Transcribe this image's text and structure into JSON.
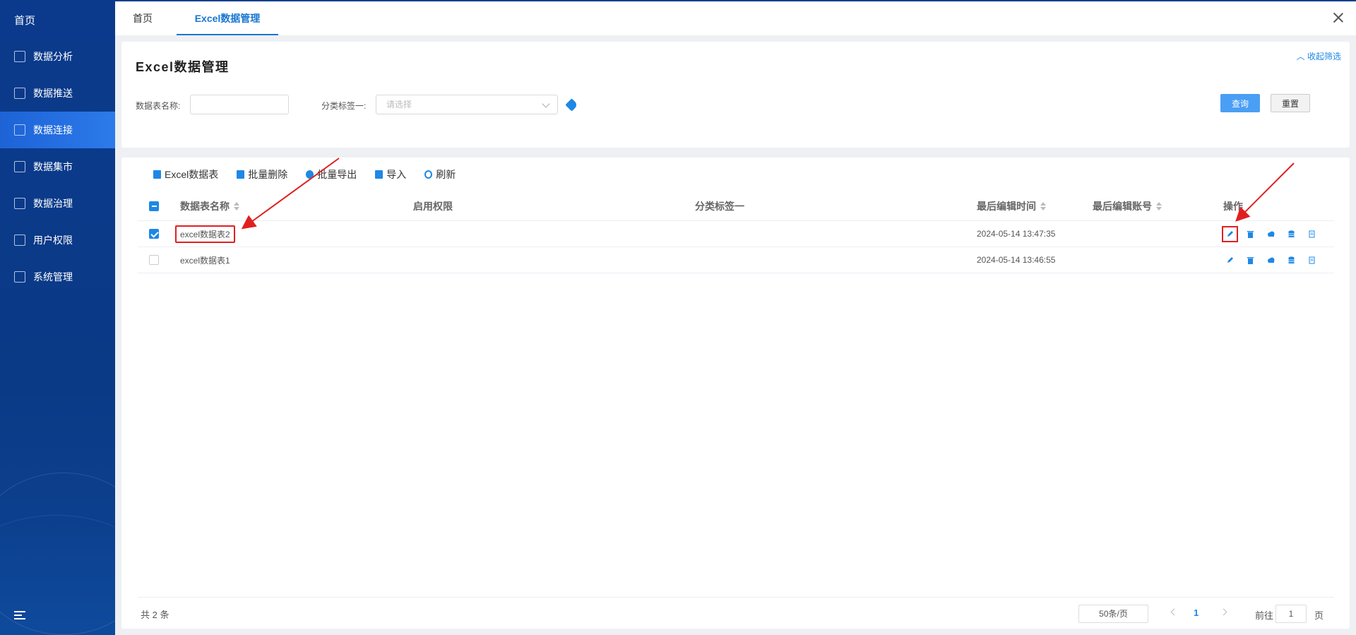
{
  "sidebar": {
    "brand": "首页",
    "items": [
      {
        "label": "数据分析",
        "icon": "chart-icon"
      },
      {
        "label": "数据推送",
        "icon": "bar-chart-icon"
      },
      {
        "label": "数据连接",
        "icon": "connection-icon",
        "active": true
      },
      {
        "label": "数据集市",
        "icon": "monitor-icon"
      },
      {
        "label": "数据治理",
        "icon": "layers-icon"
      },
      {
        "label": "用户权限",
        "icon": "user-permission-icon"
      },
      {
        "label": "系统管理",
        "icon": "system-icon"
      }
    ]
  },
  "tabs": [
    {
      "label": "首页"
    },
    {
      "label": "Excel数据管理",
      "active": true
    }
  ],
  "filter": {
    "title": "Excel数据管理",
    "collapse_label": "收起筛选",
    "name_label": "数据表名称:",
    "name_value": "",
    "tag_label": "分类标签一:",
    "tag_placeholder": "请选择",
    "query_label": "查询",
    "reset_label": "重置"
  },
  "toolbar": {
    "excel": "Excel数据表",
    "batch_delete": "批量删除",
    "batch_export": "批量导出",
    "import": "导入",
    "refresh": "刷新"
  },
  "table": {
    "headers": {
      "name": "数据表名称",
      "permission": "启用权限",
      "tag": "分类标签一",
      "time": "最后编辑时间",
      "account": "最后编辑账号",
      "ops": "操作"
    },
    "rows": [
      {
        "name": "excel数据表2",
        "permission": "",
        "tag": "",
        "time": "2024-05-14 13:47:35",
        "account": "",
        "checked": true
      },
      {
        "name": "excel数据表1",
        "permission": "",
        "tag": "",
        "time": "2024-05-14 13:46:55",
        "account": "",
        "checked": false
      }
    ]
  },
  "pagination": {
    "total": "共 2 条",
    "page_size": "50条/页",
    "current": "1",
    "goto_prefix": "前往",
    "goto_value": "1",
    "goto_suffix": "页"
  },
  "colors": {
    "accent": "#1e88e5",
    "sidebar": "#0b3a8c",
    "annotation": "#e02020"
  }
}
